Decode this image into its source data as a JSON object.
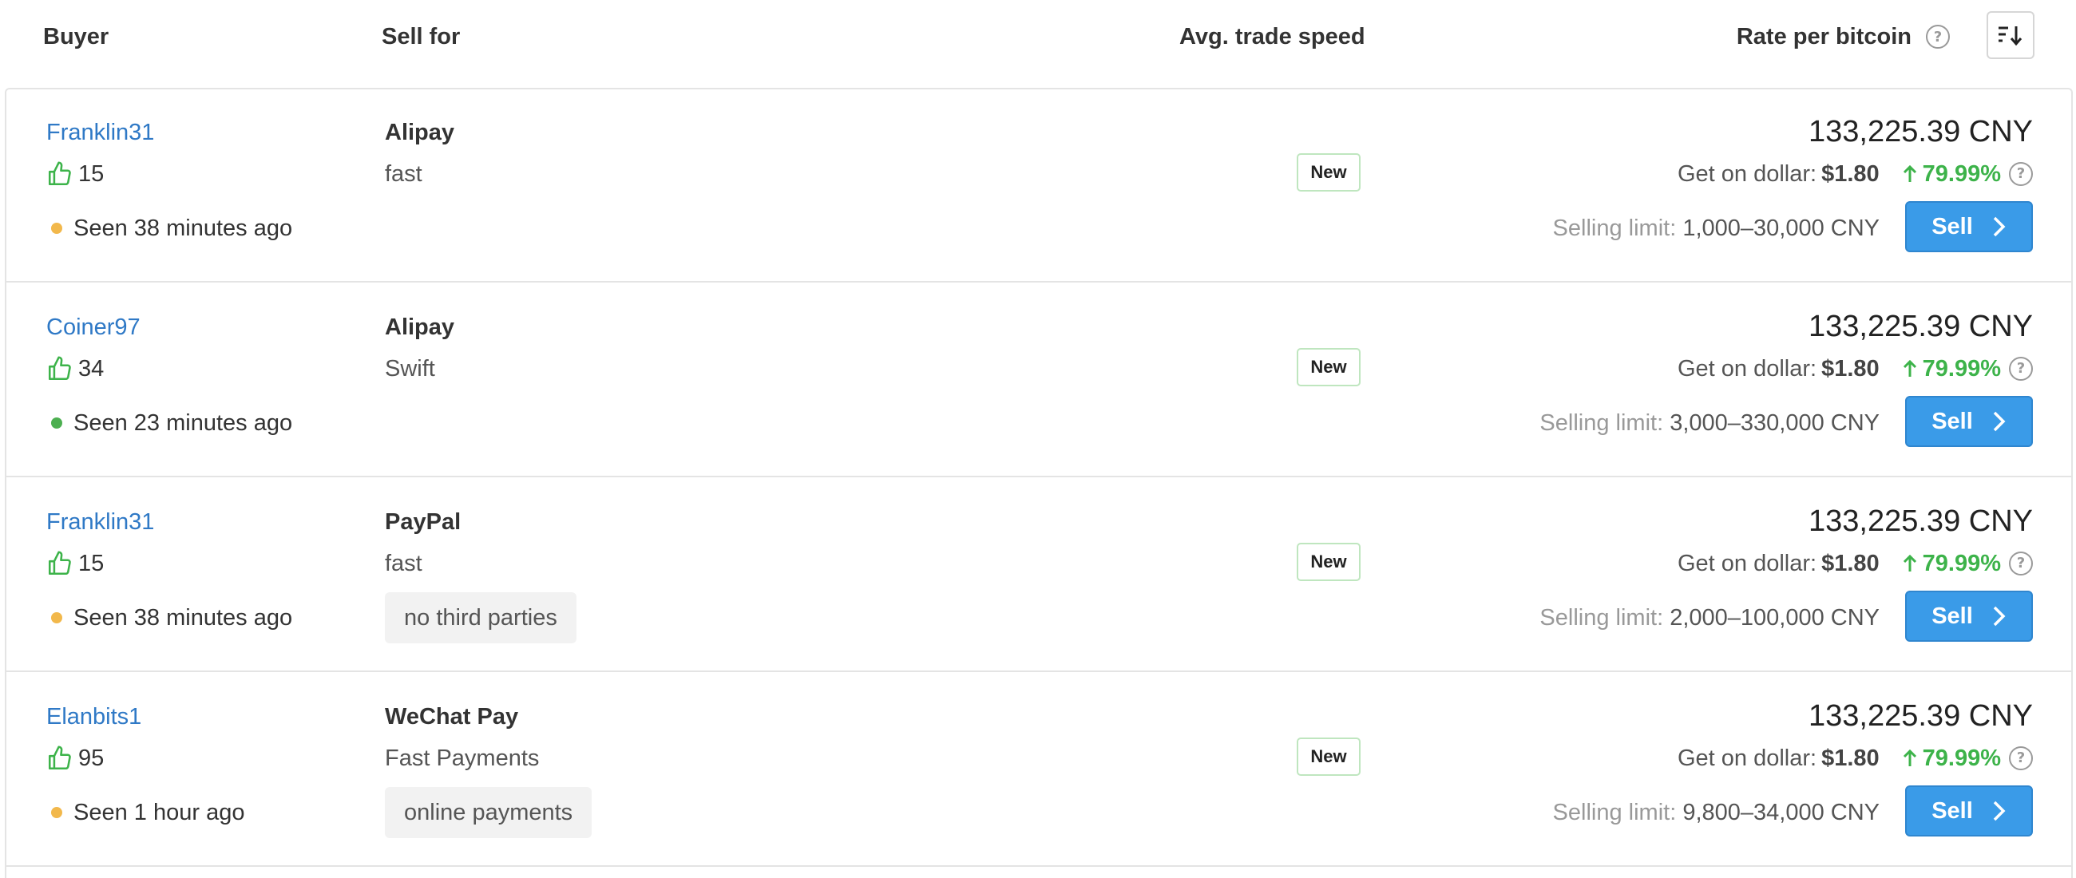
{
  "header": {
    "buyer": "Buyer",
    "sell_for": "Sell for",
    "speed": "Avg. trade speed",
    "rate": "Rate per bitcoin",
    "help": "?"
  },
  "colors": {
    "link": "#2f79c6",
    "accent": "#3a9be8",
    "positive": "#3db34a",
    "online": "#4caf50",
    "away": "#f2b84b"
  },
  "offers": [
    {
      "buyer": "Franklin31",
      "feedback": "15",
      "seen": "Seen 38 minutes ago",
      "status": "away",
      "method": "Alipay",
      "desc": "fast",
      "tag": "",
      "speed": "New",
      "price": "133,225.39 CNY",
      "dollar_label": "Get on dollar:",
      "dollar_value": "$1.80",
      "margin": "79.99%",
      "limit_label": "Selling limit:",
      "limit": "1,000–30,000 CNY",
      "sell": "Sell"
    },
    {
      "buyer": "Coiner97",
      "feedback": "34",
      "seen": "Seen 23 minutes ago",
      "status": "online",
      "method": "Alipay",
      "desc": "Swift",
      "tag": "",
      "speed": "New",
      "price": "133,225.39 CNY",
      "dollar_label": "Get on dollar:",
      "dollar_value": "$1.80",
      "margin": "79.99%",
      "limit_label": "Selling limit:",
      "limit": "3,000–330,000 CNY",
      "sell": "Sell"
    },
    {
      "buyer": "Franklin31",
      "feedback": "15",
      "seen": "Seen 38 minutes ago",
      "status": "away",
      "method": "PayPal",
      "desc": "fast",
      "tag": "no third parties",
      "speed": "New",
      "price": "133,225.39 CNY",
      "dollar_label": "Get on dollar:",
      "dollar_value": "$1.80",
      "margin": "79.99%",
      "limit_label": "Selling limit:",
      "limit": "2,000–100,000 CNY",
      "sell": "Sell"
    },
    {
      "buyer": "Elanbits1",
      "feedback": "95",
      "seen": "Seen 1 hour ago",
      "status": "away",
      "method": "WeChat Pay",
      "desc": "Fast Payments",
      "tag": "online payments",
      "speed": "New",
      "price": "133,225.39 CNY",
      "dollar_label": "Get on dollar:",
      "dollar_value": "$1.80",
      "margin": "79.99%",
      "limit_label": "Selling limit:",
      "limit": "9,800–34,000 CNY",
      "sell": "Sell"
    }
  ]
}
